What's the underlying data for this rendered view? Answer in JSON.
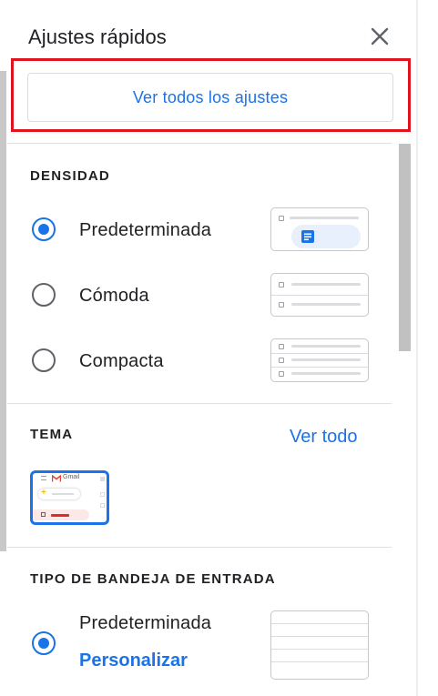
{
  "header": {
    "title": "Ajustes rápidos",
    "close_icon": "close-icon"
  },
  "all_settings_button": {
    "label": "Ver todos los ajustes"
  },
  "density": {
    "label": "DENSIDAD",
    "options": [
      {
        "label": "Predeterminada",
        "checked": true
      },
      {
        "label": "Cómoda",
        "checked": false
      },
      {
        "label": "Compacta",
        "checked": false
      }
    ]
  },
  "theme": {
    "label": "TEMA",
    "view_all": "Ver todo",
    "thumbnail_text": "Gmail"
  },
  "inbox_type": {
    "label": "TIPO DE BANDEJA DE ENTRADA",
    "options": [
      {
        "label": "Predeterminada",
        "checked": true,
        "customize": "Personalizar"
      }
    ]
  },
  "colors": {
    "accent": "#1a73e8",
    "highlight": "#e0141f",
    "text": "#202124",
    "divider": "#e0e0e0"
  }
}
